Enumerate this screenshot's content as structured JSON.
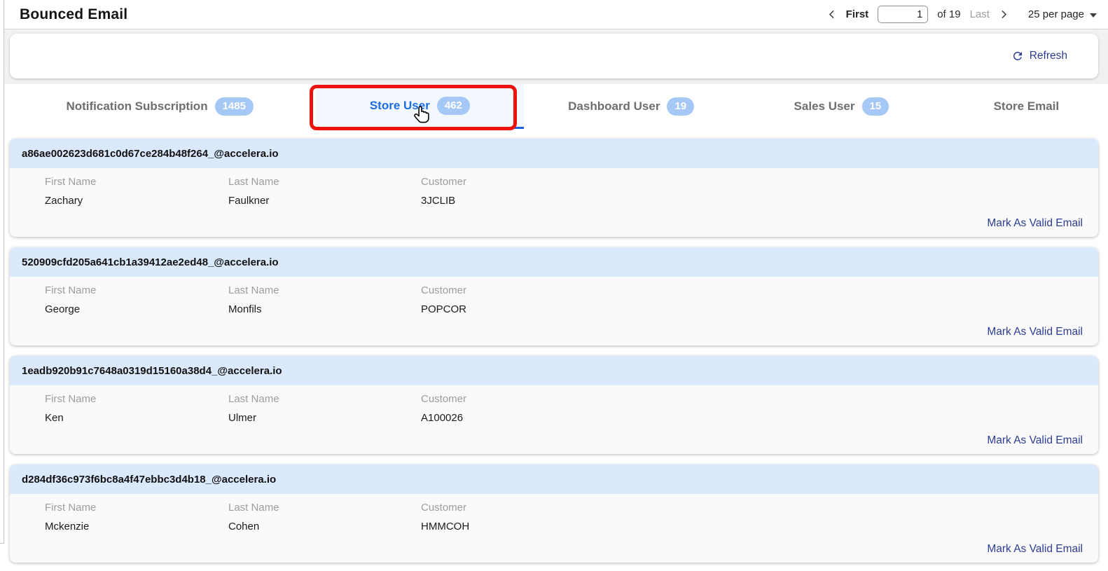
{
  "page": {
    "title": "Bounced Email"
  },
  "pagination": {
    "first_label": "First",
    "page_value": "1",
    "of_label": "of 19",
    "last_label": "Last",
    "per_page_label": "25 per page"
  },
  "toolbar": {
    "refresh_label": "Refresh"
  },
  "tabs": [
    {
      "label": "Notification Subscription",
      "count": "1485",
      "active": false
    },
    {
      "label": "Store User",
      "count": "462",
      "active": true
    },
    {
      "label": "Dashboard User",
      "count": "19",
      "active": false
    },
    {
      "label": "Sales User",
      "count": "15",
      "active": false
    },
    {
      "label": "Store Email",
      "count": "",
      "active": false
    }
  ],
  "field_labels": {
    "first_name": "First Name",
    "last_name": "Last Name",
    "customer": "Customer"
  },
  "action_label": "Mark As Valid Email",
  "cards": [
    {
      "email": "a86ae002623d681c0d67ce284b48f264_@accelera.io",
      "first_name": "Zachary",
      "last_name": "Faulkner",
      "customer": "3JCLIB"
    },
    {
      "email": "520909cfd205a641cb1a39412ae2ed48_@accelera.io",
      "first_name": "George",
      "last_name": "Monfils",
      "customer": "POPCOR"
    },
    {
      "email": "1eadb920b91c7648a0319d15160a38d4_@accelera.io",
      "first_name": "Ken",
      "last_name": "Ulmer",
      "customer": "A100026"
    },
    {
      "email": "d284df36c973f6bc8a4f47ebbc3d4b18_@accelera.io",
      "first_name": "Mckenzie",
      "last_name": "Cohen",
      "customer": "HMMCOH"
    }
  ],
  "colors": {
    "accent_blue": "#1c6ce8",
    "badge_blue": "#a5c8f7",
    "card_header_blue": "#dbe9fc",
    "link_navy": "#2c3c92",
    "annotation_red": "#ea140c",
    "band_gray": "#f0f1f2"
  }
}
